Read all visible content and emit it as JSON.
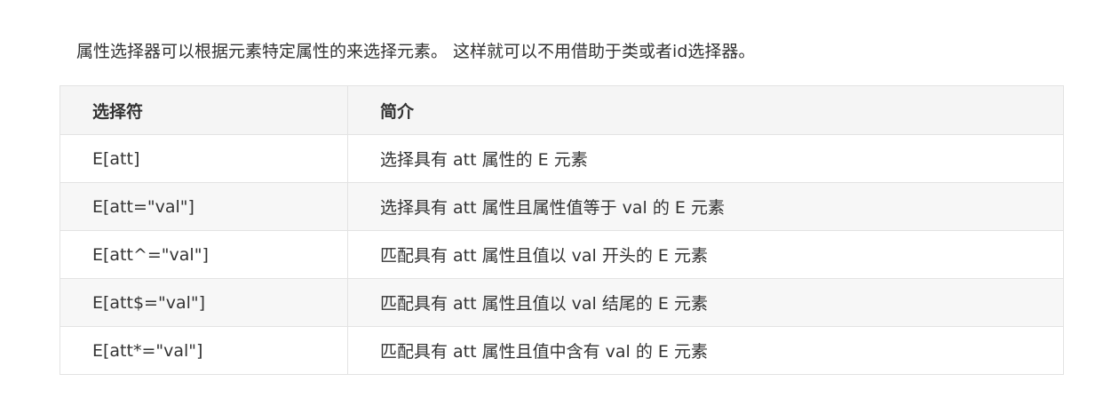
{
  "intro": "属性选择器可以根据元素特定属性的来选择元素。 这样就可以不用借助于类或者id选择器。",
  "table": {
    "headers": [
      "选择符",
      "简介"
    ],
    "rows": [
      {
        "selector": "E[att]",
        "description": "选择具有 att 属性的 E 元素"
      },
      {
        "selector": "E[att=\"val\"]",
        "description": "选择具有 att 属性且属性值等于 val 的 E 元素"
      },
      {
        "selector": "E[att^=\"val\"]",
        "description": "匹配具有 att 属性且值以 val 开头的 E 元素"
      },
      {
        "selector": "E[att$=\"val\"]",
        "description": "匹配具有 att 属性且值以 val 结尾的 E 元素"
      },
      {
        "selector": "E[att*=\"val\"]",
        "description": "匹配具有 att 属性且值中含有 val 的 E 元素"
      }
    ]
  }
}
